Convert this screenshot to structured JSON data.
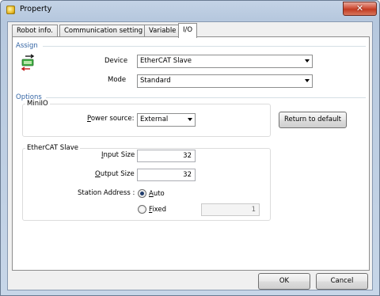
{
  "window": {
    "title": "Property",
    "close_glyph": "✕"
  },
  "tabs": [
    {
      "label": "Robot info."
    },
    {
      "label": "Communication setting"
    },
    {
      "label": "Variable"
    },
    {
      "label": "I/O",
      "active": true
    }
  ],
  "assign": {
    "section_label": "Assign",
    "icon": "ethercat-device-icon",
    "device_label": "Device",
    "device_value": "EtherCAT Slave",
    "mode_label": "Mode",
    "mode_value": "Standard"
  },
  "options": {
    "section_label": "Options",
    "miniio": {
      "group_label": "MiniIO",
      "power_source_label_prefix": "",
      "power_source_label_ul": "P",
      "power_source_label_rest": "ower source:",
      "power_source_value": "External"
    },
    "return_default_label": "Return to default",
    "ethercat": {
      "group_label": "EtherCAT Slave",
      "input_size_ul": "I",
      "input_size_rest": "nput Size",
      "input_size_value": "32",
      "output_size_ul": "O",
      "output_size_rest": "utput Size",
      "output_size_value": "32",
      "station_address_label": "Station Address :",
      "auto_ul": "A",
      "auto_rest": "uto",
      "auto_checked": true,
      "fixed_ul": "F",
      "fixed_rest": "ixed",
      "fixed_value": "1"
    }
  },
  "footer": {
    "ok_label": "OK",
    "cancel_label": "Cancel"
  }
}
